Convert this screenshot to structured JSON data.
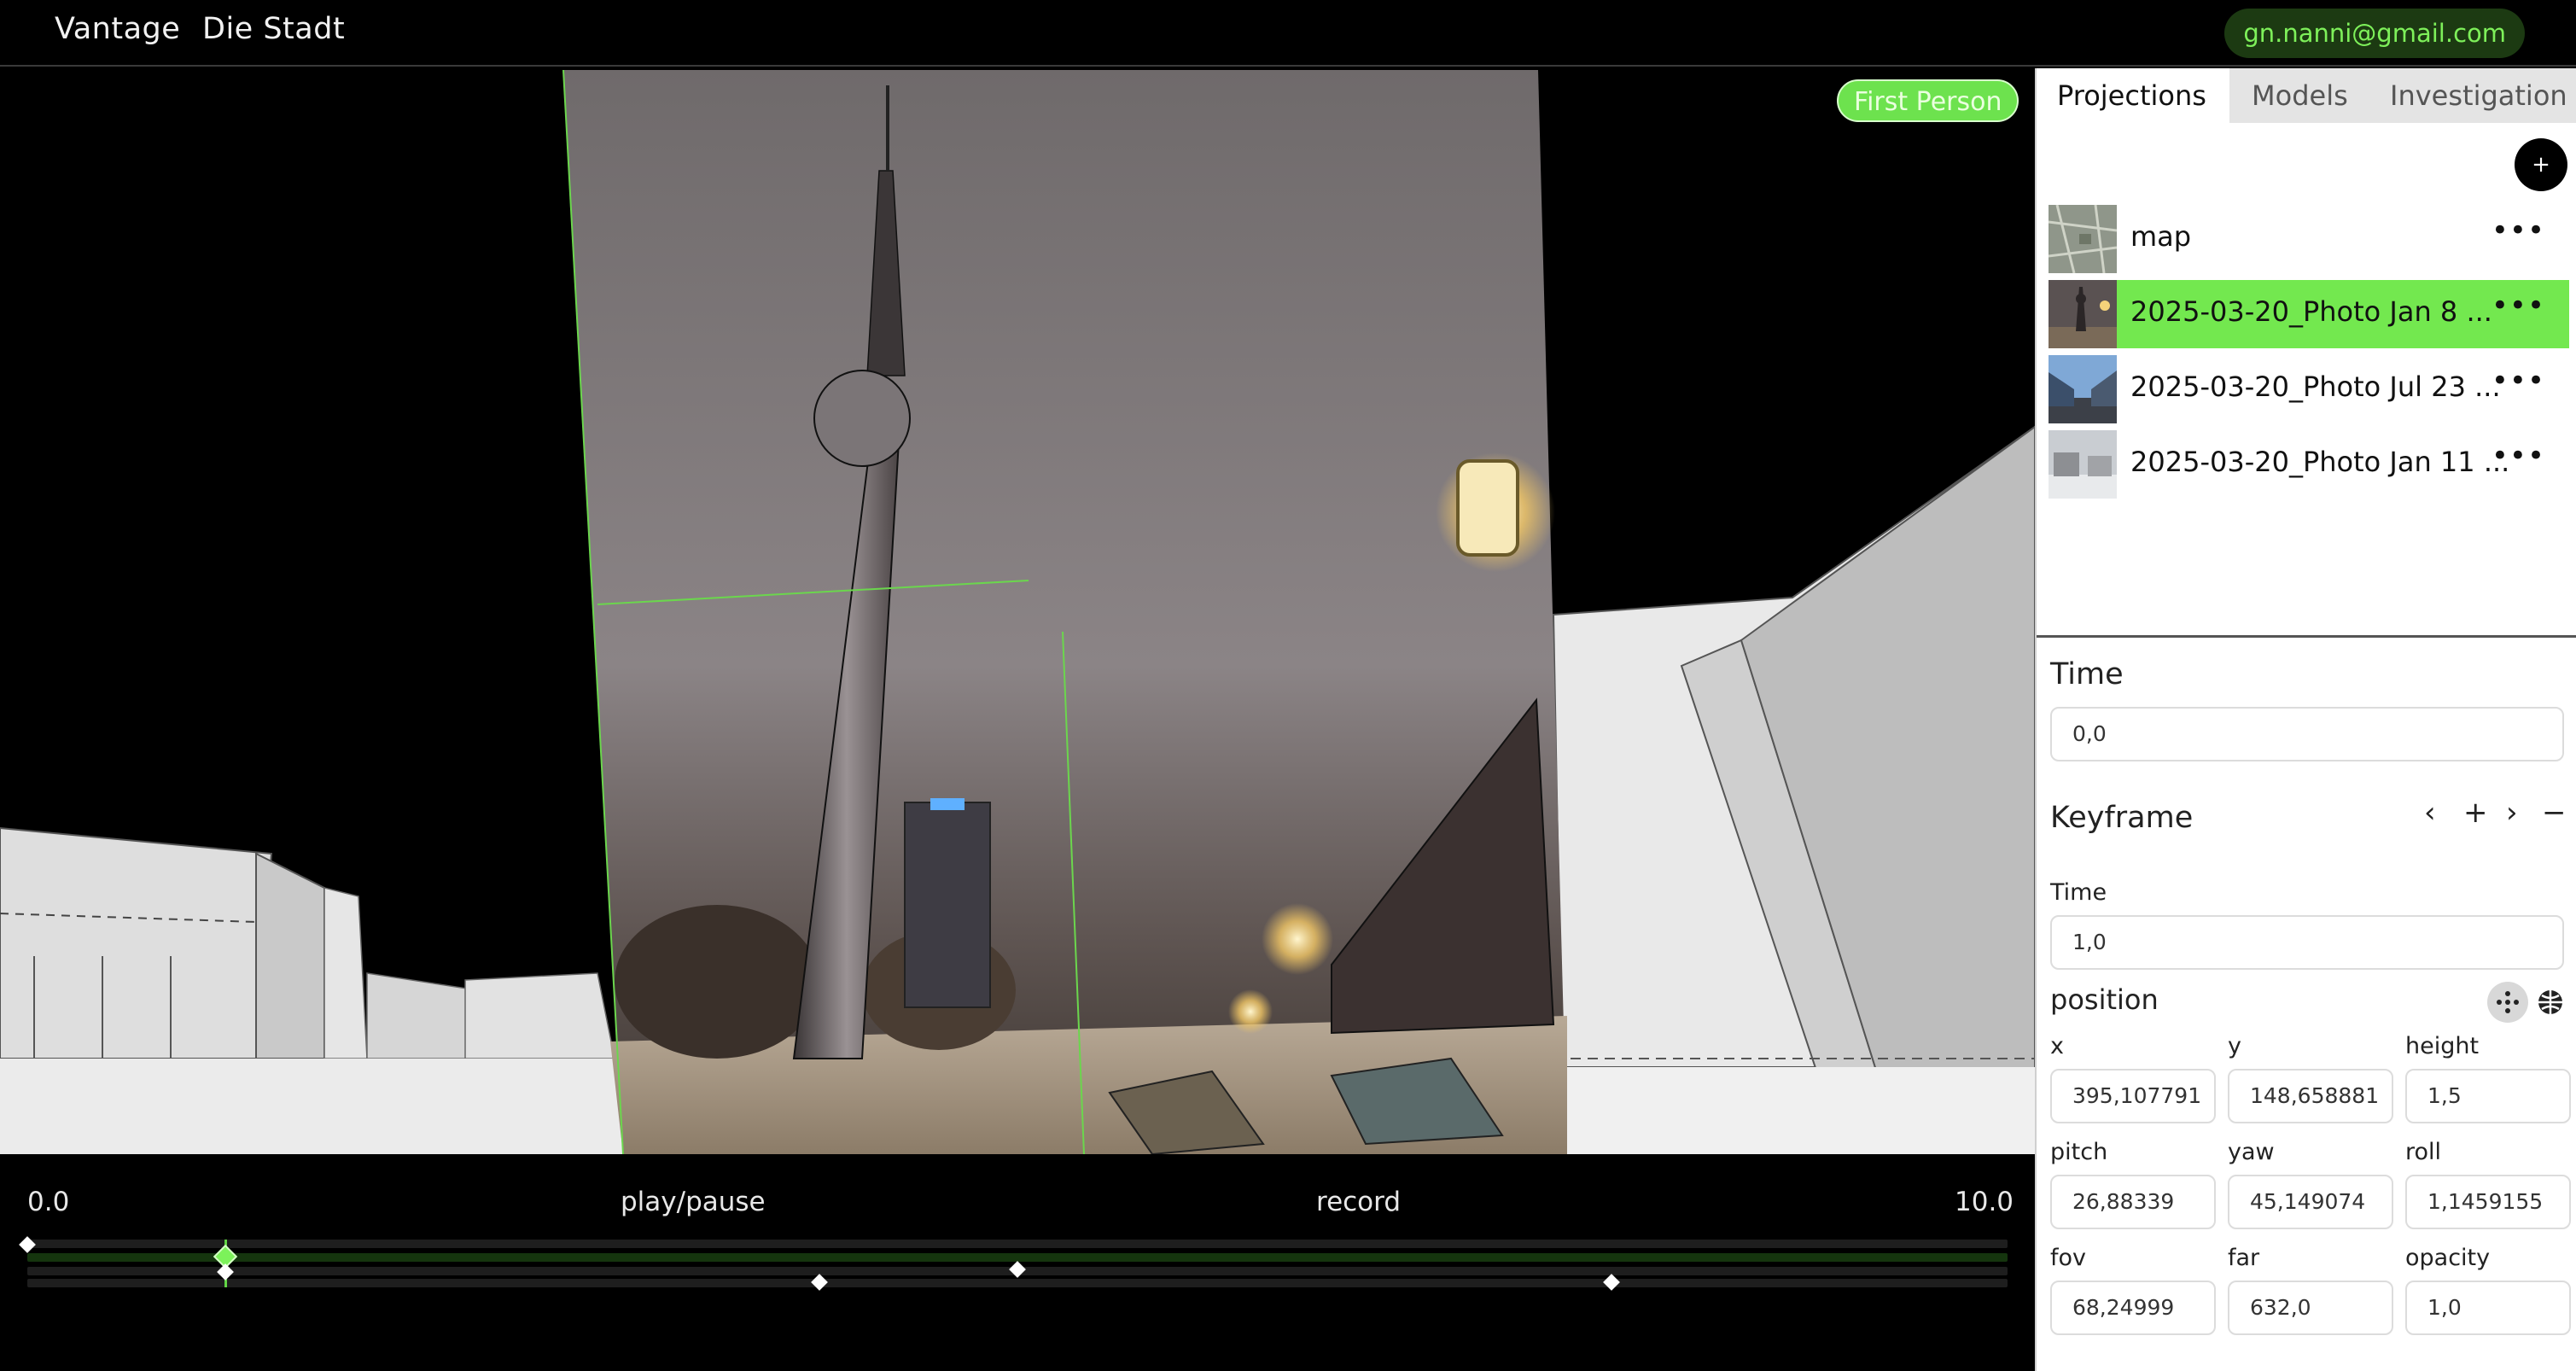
{
  "header": {
    "brand": "Vantage",
    "project": "Die Stadt",
    "user_email": "gn.nanni@gmail.com"
  },
  "viewport": {
    "mode_label": "First Person"
  },
  "timeline": {
    "start": "0.0",
    "end": "10.0",
    "play_label": "play/pause",
    "record_label": "record"
  },
  "panel": {
    "tabs": [
      {
        "label": "Projections",
        "active": true
      },
      {
        "label": "Models",
        "active": false
      },
      {
        "label": "Investigation",
        "active": false
      }
    ],
    "add_label": "+",
    "projections": [
      {
        "label": "map",
        "selected": false,
        "thumb": "map-thumbnail"
      },
      {
        "label": "2025-03-20_Photo Jan 8 ...",
        "selected": true,
        "thumb": "night-tower-thumbnail"
      },
      {
        "label": "2025-03-20_Photo Jul 23 ...",
        "selected": false,
        "thumb": "street-day-thumbnail"
      },
      {
        "label": "2025-03-20_Photo Jan 11 ...",
        "selected": false,
        "thumb": "snow-square-thumbnail"
      }
    ],
    "more_icon_text": "•••",
    "time_section": {
      "title": "Time",
      "value": "0,0"
    },
    "keyframe_section": {
      "title": "Keyframe",
      "controls": {
        "prev": "‹",
        "add": "+",
        "next": "›",
        "remove": "−"
      },
      "time_label": "Time",
      "time_value": "1,0"
    },
    "position_section": {
      "title": "position",
      "fields": [
        {
          "label": "x",
          "value": "395,107791"
        },
        {
          "label": "y",
          "value": "148,658881"
        },
        {
          "label": "height",
          "value": "1,5"
        },
        {
          "label": "pitch",
          "value": "26,88339"
        },
        {
          "label": "yaw",
          "value": "45,149074"
        },
        {
          "label": "roll",
          "value": "1,1459155"
        },
        {
          "label": "fov",
          "value": "68,24999"
        },
        {
          "label": "far",
          "value": "632,0"
        },
        {
          "label": "opacity",
          "value": "1,0"
        }
      ]
    }
  },
  "colors": {
    "accent_green": "#73e84f",
    "pill_dark_green": "#1c3a12",
    "panel_bg": "#ffffff",
    "app_bg": "#000000"
  }
}
